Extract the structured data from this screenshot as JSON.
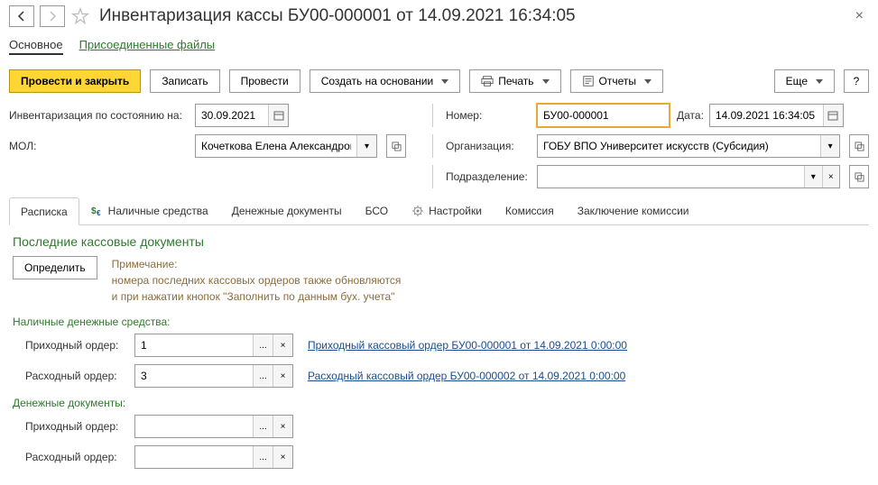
{
  "header": {
    "title": "Инвентаризация кассы БУ00-000001 от 14.09.2021 16:34:05"
  },
  "section_tabs": {
    "main": "Основное",
    "files": "Присоединенные файлы"
  },
  "toolbar": {
    "post_close": "Провести и закрыть",
    "save": "Записать",
    "post": "Провести",
    "create_based": "Создать на основании",
    "print": "Печать",
    "reports": "Отчеты",
    "more": "Еще",
    "help": "?"
  },
  "form": {
    "inventory_date_label": "Инвентаризация по состоянию на:",
    "inventory_date": "30.09.2021",
    "number_label": "Номер:",
    "number": "БУ00-000001",
    "date_label": "Дата:",
    "date": "14.09.2021 16:34:05",
    "mol_label": "МОЛ:",
    "mol": "Кочеткова Елена Александровна",
    "org_label": "Организация:",
    "org": "ГОБУ ВПО Университет искусств (Субсидия)",
    "dept_label": "Подразделение:",
    "dept": ""
  },
  "tabs": {
    "t1": "Расписка",
    "t2": "Наличные средства",
    "t3": "Денежные документы",
    "t4": "БСО",
    "t5": "Настройки",
    "t6": "Комиссия",
    "t7": "Заключение комиссии"
  },
  "content": {
    "section_title": "Последние кассовые документы",
    "determine": "Определить",
    "note_label": "Примечание:",
    "note_line1": "номера последних кассовых ордеров также обновляются",
    "note_line2": "и при нажатии кнопок \"Заполнить по данным бух. учета\"",
    "cash_section": "Наличные денежные средства:",
    "docs_section": "Денежные документы:",
    "income_label": "Приходный ордер:",
    "expense_label": "Расходный ордер:",
    "income_val": "1",
    "expense_val": "3",
    "income_link": "Приходный кассовый ордер БУ00-000001 от 14.09.2021 0:00:00",
    "expense_link": "Расходный кассовый ордер БУ00-000002 от 14.09.2021 0:00:00",
    "docs_income_val": "",
    "docs_expense_val": ""
  }
}
